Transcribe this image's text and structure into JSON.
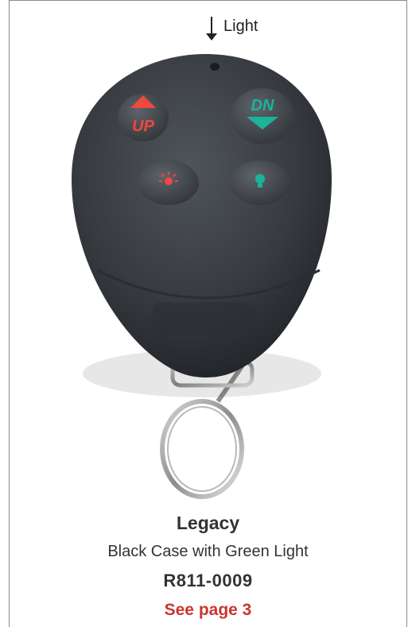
{
  "indicator": {
    "label": "Light",
    "icon": "down-arrow-icon"
  },
  "photo": {
    "subject": "remote-keyfob",
    "buttons": [
      {
        "name": "up-button",
        "text": "UP",
        "color": "#f0473e"
      },
      {
        "name": "down-button",
        "text": "DN",
        "color": "#19b49a"
      },
      {
        "name": "light-button",
        "icon": "light-bulb-icon",
        "color": "#f0473e"
      },
      {
        "name": "green-light-button",
        "icon": "bulb-icon",
        "color": "#19b49a"
      }
    ]
  },
  "product": {
    "name": "Legacy",
    "description": "Black Case with Green Light",
    "part_number": "R811-0009",
    "page_ref": "See page 3"
  },
  "colors": {
    "accent": "#c8372d",
    "text": "#333333",
    "frame": "#8a8a8a"
  }
}
